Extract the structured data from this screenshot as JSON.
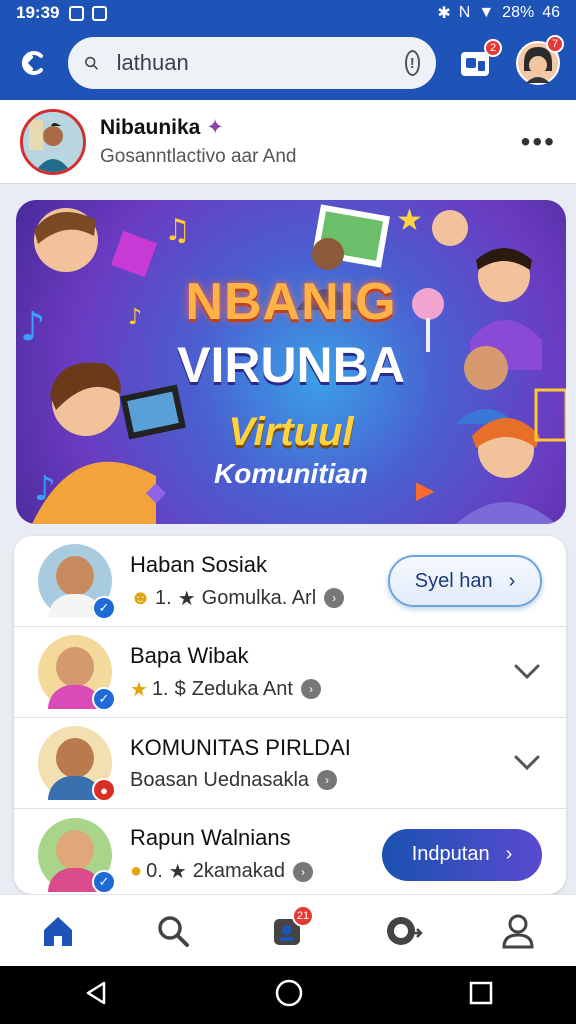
{
  "status_bar": {
    "time": "19:39",
    "battery": "28%",
    "network": "46"
  },
  "search": {
    "query": "lathuan"
  },
  "header_badges": {
    "notifications": "2",
    "profile": "7"
  },
  "profile": {
    "name": "Nibaunika",
    "subtitle": "Gosanntlactivo aar And"
  },
  "banner": {
    "line1": "NBANIG",
    "line2": "VIRUNBA",
    "line3": "Virtuul",
    "line4": "Komunitian"
  },
  "list": [
    {
      "title": "Haban Sosiak",
      "sub_prefix": "1.",
      "sub_text": "Gomulka. Arl",
      "action": "Syel han",
      "action_style": "light",
      "verify_color": "#1e6ad8"
    },
    {
      "title": "Bapa Wibak",
      "sub_prefix": "1.",
      "sub_text": "Zeduka Ant",
      "action": "",
      "action_style": "chevron",
      "verify_color": "#1e6ad8"
    },
    {
      "title": "KOMUNITAS PIRLDAI",
      "sub_prefix": "",
      "sub_text": "Boasan Uednasakla",
      "action": "",
      "action_style": "chevron",
      "verify_color": "#d93025"
    },
    {
      "title": "Rapun Walnians",
      "sub_prefix": "0.",
      "sub_text": "2kamakad",
      "action": "Indputan",
      "action_style": "dark",
      "verify_color": "#1e6ad8"
    }
  ],
  "bottom_nav": {
    "badge": "21",
    "items": [
      "home-icon",
      "search-icon",
      "chat-icon",
      "community-icon",
      "profile-icon"
    ]
  },
  "colors": {
    "primary": "#1e54b8",
    "accent": "#5a4ad0",
    "badge": "#e53935"
  }
}
